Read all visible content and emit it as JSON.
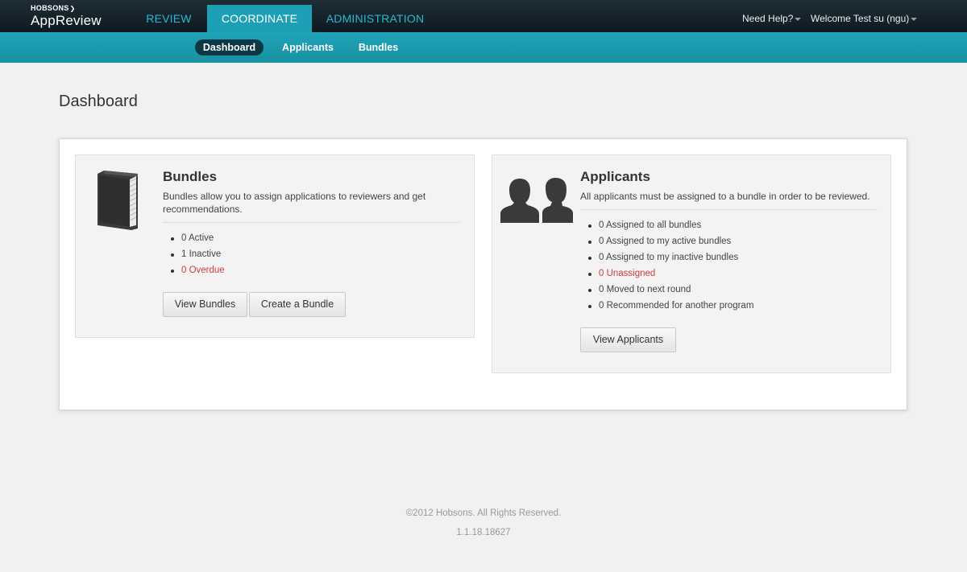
{
  "header": {
    "logo_small": "HOBSONS",
    "logo_big": "AppReview",
    "tabs": [
      {
        "label": "REVIEW"
      },
      {
        "label": "COORDINATE"
      },
      {
        "label": "ADMINISTRATION"
      }
    ],
    "need_help": "Need Help?",
    "welcome": "Welcome Test su (ngu)"
  },
  "subnav": {
    "items": [
      {
        "label": "Dashboard"
      },
      {
        "label": "Applicants"
      },
      {
        "label": "Bundles"
      }
    ]
  },
  "page": {
    "title": "Dashboard"
  },
  "bundles_card": {
    "title": "Bundles",
    "description": "Bundles allow you to assign applications to reviewers and get recommendations.",
    "stats": [
      "0 Active",
      "1 Inactive",
      "0 Overdue"
    ],
    "view_button": "View Bundles",
    "create_button": "Create a Bundle"
  },
  "applicants_card": {
    "title": "Applicants",
    "description": "All applicants must be assigned to a bundle in order to be reviewed.",
    "stats": [
      "0 Assigned to all bundles",
      "0 Assigned to my active bundles",
      "0 Assigned to my inactive bundles",
      "0 Unassigned",
      "0 Moved to next round",
      "0 Recommended for another program"
    ],
    "view_button": "View Applicants"
  },
  "footer": {
    "copyright": "©2012 Hobsons. All Rights Reserved.",
    "version": "1.1.18.18627"
  },
  "colors": {
    "accent": "#1d9fb6",
    "alert": "#d23b3b",
    "topbar": "#16232b"
  },
  "icons": {
    "bundles": "book-icon",
    "applicants": "people-icon"
  }
}
